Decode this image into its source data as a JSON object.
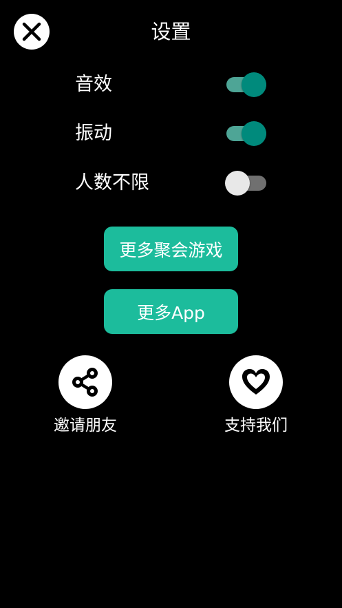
{
  "header": {
    "title": "设置",
    "close_icon": "close-icon"
  },
  "settings": [
    {
      "label": "音效",
      "on": true
    },
    {
      "label": "振动",
      "on": true
    },
    {
      "label": "人数不限",
      "on": false
    }
  ],
  "buttons": {
    "more_party_games": "更多聚会游戏",
    "more_apps": "更多App"
  },
  "actions": {
    "invite": {
      "label": "邀请朋友",
      "icon": "share-icon"
    },
    "support": {
      "label": "支持我们",
      "icon": "heart-icon"
    }
  },
  "colors": {
    "background": "#000000",
    "accent": "#1cbc9c",
    "toggle_on_knob": "#008a7c",
    "toggle_on_track": "#4ea596",
    "toggle_off_knob": "#e8e8e8",
    "toggle_off_track": "#707070"
  }
}
